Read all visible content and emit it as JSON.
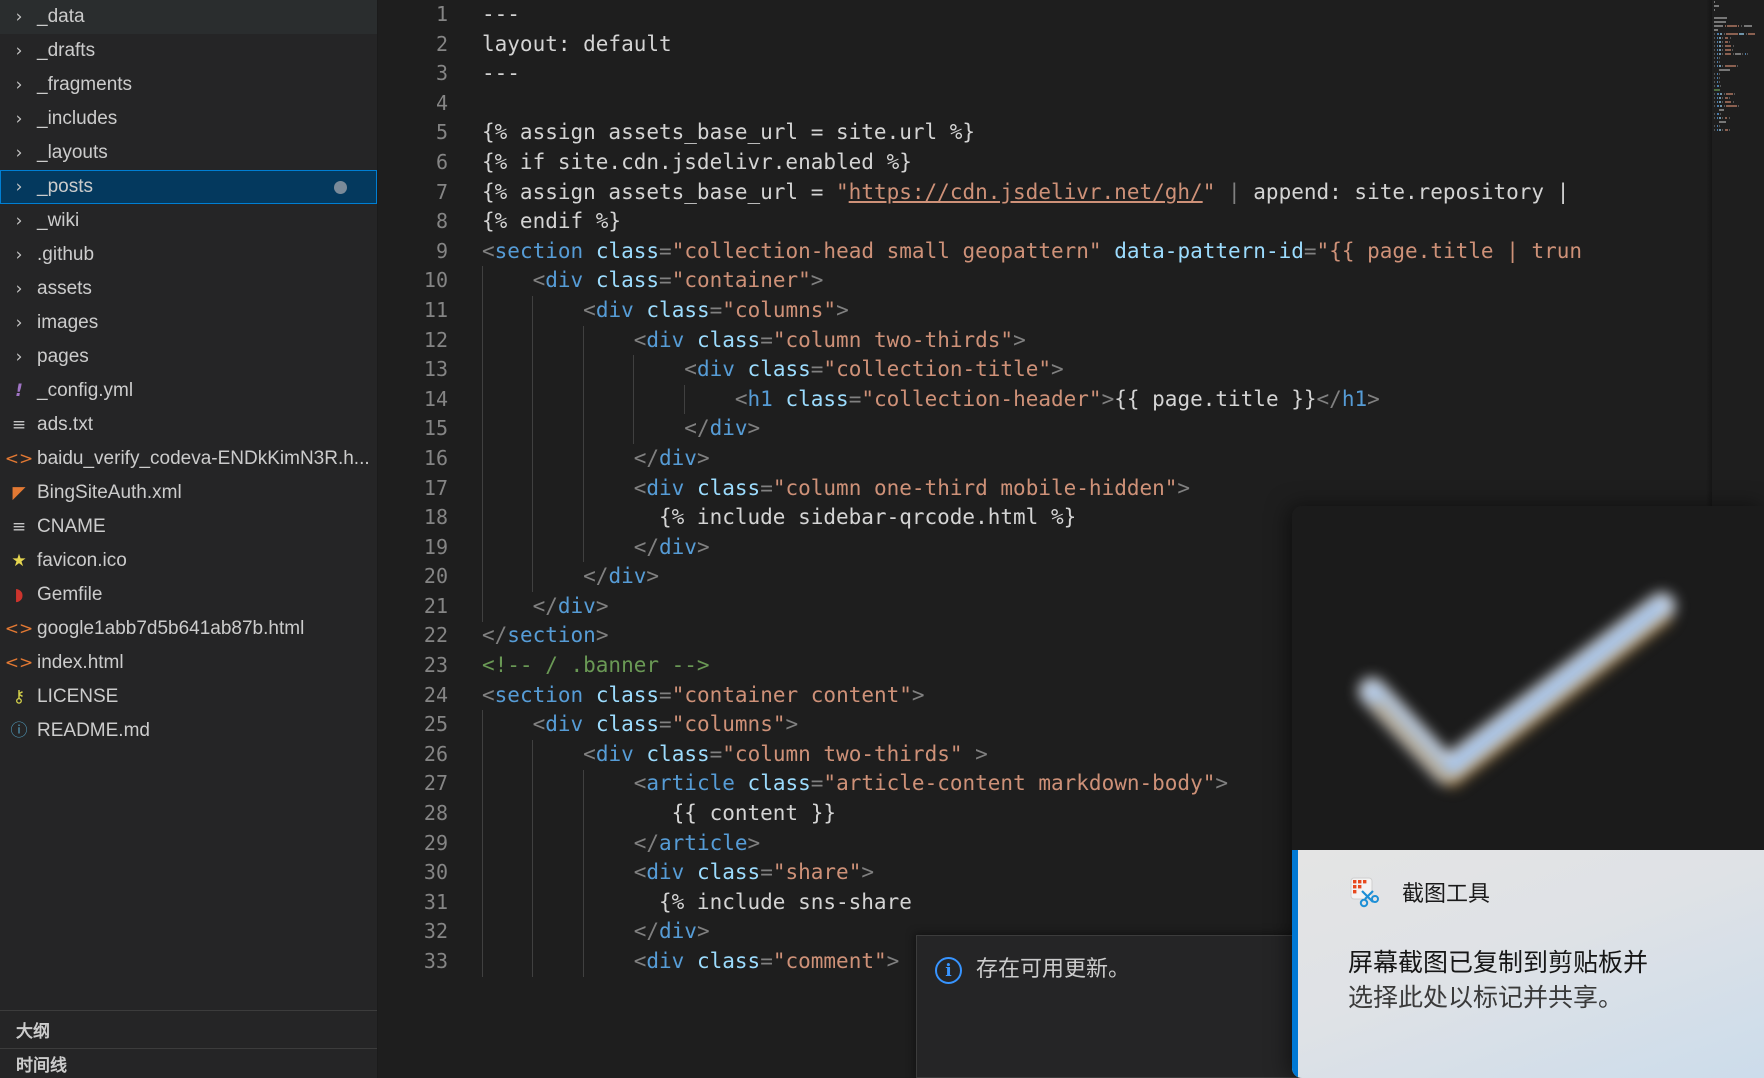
{
  "sidebar": {
    "explorer_items": [
      {
        "label": "_data",
        "kind": "folder",
        "icon": "chevron-right-icon",
        "state": "hovered"
      },
      {
        "label": "_drafts",
        "kind": "folder",
        "icon": "chevron-right-icon",
        "state": "normal"
      },
      {
        "label": "_fragments",
        "kind": "folder",
        "icon": "chevron-right-icon",
        "state": "normal"
      },
      {
        "label": "_includes",
        "kind": "folder",
        "icon": "chevron-right-icon",
        "state": "normal"
      },
      {
        "label": "_layouts",
        "kind": "folder",
        "icon": "chevron-right-icon",
        "state": "normal"
      },
      {
        "label": "_posts",
        "kind": "folder",
        "icon": "chevron-right-icon",
        "state": "selected",
        "badge": "dirty-dot"
      },
      {
        "label": "_wiki",
        "kind": "folder",
        "icon": "chevron-right-icon",
        "state": "normal"
      },
      {
        "label": ".github",
        "kind": "folder",
        "icon": "chevron-right-icon",
        "state": "normal"
      },
      {
        "label": "assets",
        "kind": "folder",
        "icon": "chevron-right-icon",
        "state": "normal"
      },
      {
        "label": "images",
        "kind": "folder",
        "icon": "chevron-right-icon",
        "state": "normal"
      },
      {
        "label": "pages",
        "kind": "folder",
        "icon": "chevron-right-icon",
        "state": "normal"
      },
      {
        "label": "_config.yml",
        "kind": "file",
        "icon": "yaml-file-icon",
        "glyph": "!",
        "color": "#a074c4"
      },
      {
        "label": "ads.txt",
        "kind": "file",
        "icon": "text-file-icon",
        "glyph": "≡",
        "color": "#c5c5c5"
      },
      {
        "label": "baidu_verify_codeva-ENDkKimN3R.h...",
        "kind": "file",
        "icon": "html-file-icon",
        "glyph": "<>",
        "color": "#e37933"
      },
      {
        "label": "BingSiteAuth.xml",
        "kind": "file",
        "icon": "xml-file-icon",
        "glyph": "◤",
        "color": "#e37933"
      },
      {
        "label": "CNAME",
        "kind": "file",
        "icon": "text-file-icon",
        "glyph": "≡",
        "color": "#c5c5c5"
      },
      {
        "label": "favicon.ico",
        "kind": "file",
        "icon": "star-file-icon",
        "glyph": "★",
        "color": "#e5d54f"
      },
      {
        "label": "Gemfile",
        "kind": "file",
        "icon": "ruby-gem-icon",
        "glyph": "◗",
        "color": "#cc342d"
      },
      {
        "label": "google1abb7d5b641ab87b.html",
        "kind": "file",
        "icon": "html-file-icon",
        "glyph": "<>",
        "color": "#e37933"
      },
      {
        "label": "index.html",
        "kind": "file",
        "icon": "html-file-icon",
        "glyph": "<>",
        "color": "#e37933"
      },
      {
        "label": "LICENSE",
        "kind": "file",
        "icon": "key-file-icon",
        "glyph": "⚷",
        "color": "#d4d14a"
      },
      {
        "label": "README.md",
        "kind": "file",
        "icon": "markdown-info-icon",
        "glyph": "ⓘ",
        "color": "#519aba"
      }
    ],
    "outline_label": "大纲",
    "timeline_label": "时间线"
  },
  "editor": {
    "first_visible_line": 1,
    "lines": [
      {
        "n": "1",
        "tokens": [
          {
            "t": "def",
            "v": "---"
          }
        ]
      },
      {
        "n": "2",
        "tokens": [
          {
            "t": "def",
            "v": "layout: default"
          }
        ]
      },
      {
        "n": "3",
        "tokens": [
          {
            "t": "def",
            "v": "---"
          }
        ]
      },
      {
        "n": "4",
        "tokens": [
          {
            "t": "def",
            "v": ""
          }
        ]
      },
      {
        "n": "5",
        "tokens": [
          {
            "t": "def",
            "v": "{% assign assets_base_url = site.url %}"
          }
        ]
      },
      {
        "n": "6",
        "tokens": [
          {
            "t": "def",
            "v": "{% if site.cdn.jsdelivr.enabled %}"
          }
        ]
      },
      {
        "n": "7",
        "tokens": [
          {
            "t": "def",
            "v": "{% assign assets_base_url = "
          },
          {
            "t": "str",
            "v": "\""
          },
          {
            "t": "link",
            "v": "https://cdn.jsdelivr.net/gh/"
          },
          {
            "t": "str",
            "v": "\""
          },
          {
            "t": "punc",
            "v": " | "
          },
          {
            "t": "def",
            "v": "append: site.repository |"
          }
        ]
      },
      {
        "n": "8",
        "tokens": [
          {
            "t": "def",
            "v": "{% endif %}"
          }
        ]
      },
      {
        "n": "9",
        "tokens": [
          {
            "t": "punc",
            "v": "<"
          },
          {
            "t": "tag",
            "v": "section"
          },
          {
            "t": "def",
            "v": " "
          },
          {
            "t": "attr",
            "v": "class"
          },
          {
            "t": "punc",
            "v": "="
          },
          {
            "t": "str",
            "v": "\"collection-head small geopattern\""
          },
          {
            "t": "def",
            "v": " "
          },
          {
            "t": "attr",
            "v": "data-pattern-id"
          },
          {
            "t": "punc",
            "v": "="
          },
          {
            "t": "str",
            "v": "\"{{ page.title | trun"
          }
        ]
      },
      {
        "n": "10",
        "tokens": [
          {
            "t": "def",
            "v": "    "
          },
          {
            "t": "punc",
            "v": "<"
          },
          {
            "t": "tag",
            "v": "div"
          },
          {
            "t": "def",
            "v": " "
          },
          {
            "t": "attr",
            "v": "class"
          },
          {
            "t": "punc",
            "v": "="
          },
          {
            "t": "str",
            "v": "\"container\""
          },
          {
            "t": "punc",
            "v": ">"
          }
        ]
      },
      {
        "n": "11",
        "tokens": [
          {
            "t": "def",
            "v": "        "
          },
          {
            "t": "punc",
            "v": "<"
          },
          {
            "t": "tag",
            "v": "div"
          },
          {
            "t": "def",
            "v": " "
          },
          {
            "t": "attr",
            "v": "class"
          },
          {
            "t": "punc",
            "v": "="
          },
          {
            "t": "str",
            "v": "\"columns\""
          },
          {
            "t": "punc",
            "v": ">"
          }
        ]
      },
      {
        "n": "12",
        "tokens": [
          {
            "t": "def",
            "v": "            "
          },
          {
            "t": "punc",
            "v": "<"
          },
          {
            "t": "tag",
            "v": "div"
          },
          {
            "t": "def",
            "v": " "
          },
          {
            "t": "attr",
            "v": "class"
          },
          {
            "t": "punc",
            "v": "="
          },
          {
            "t": "str",
            "v": "\"column two-thirds\""
          },
          {
            "t": "punc",
            "v": ">"
          }
        ]
      },
      {
        "n": "13",
        "tokens": [
          {
            "t": "def",
            "v": "                "
          },
          {
            "t": "punc",
            "v": "<"
          },
          {
            "t": "tag",
            "v": "div"
          },
          {
            "t": "def",
            "v": " "
          },
          {
            "t": "attr",
            "v": "class"
          },
          {
            "t": "punc",
            "v": "="
          },
          {
            "t": "str",
            "v": "\"collection-title\""
          },
          {
            "t": "punc",
            "v": ">"
          }
        ]
      },
      {
        "n": "14",
        "tokens": [
          {
            "t": "def",
            "v": "                    "
          },
          {
            "t": "punc",
            "v": "<"
          },
          {
            "t": "tag",
            "v": "h1"
          },
          {
            "t": "def",
            "v": " "
          },
          {
            "t": "attr",
            "v": "class"
          },
          {
            "t": "punc",
            "v": "="
          },
          {
            "t": "str",
            "v": "\"collection-header\""
          },
          {
            "t": "punc",
            "v": ">"
          },
          {
            "t": "def",
            "v": "{{ page.title }}"
          },
          {
            "t": "punc",
            "v": "</"
          },
          {
            "t": "tag",
            "v": "h1"
          },
          {
            "t": "punc",
            "v": ">"
          }
        ]
      },
      {
        "n": "15",
        "tokens": [
          {
            "t": "def",
            "v": "                "
          },
          {
            "t": "punc",
            "v": "</"
          },
          {
            "t": "tag",
            "v": "div"
          },
          {
            "t": "punc",
            "v": ">"
          }
        ]
      },
      {
        "n": "16",
        "tokens": [
          {
            "t": "def",
            "v": "            "
          },
          {
            "t": "punc",
            "v": "</"
          },
          {
            "t": "tag",
            "v": "div"
          },
          {
            "t": "punc",
            "v": ">"
          }
        ]
      },
      {
        "n": "17",
        "tokens": [
          {
            "t": "def",
            "v": "            "
          },
          {
            "t": "punc",
            "v": "<"
          },
          {
            "t": "tag",
            "v": "div"
          },
          {
            "t": "def",
            "v": " "
          },
          {
            "t": "attr",
            "v": "class"
          },
          {
            "t": "punc",
            "v": "="
          },
          {
            "t": "str",
            "v": "\"column one-third mobile-hidden\""
          },
          {
            "t": "punc",
            "v": ">"
          }
        ]
      },
      {
        "n": "18",
        "tokens": [
          {
            "t": "def",
            "v": "              {% include sidebar-qrcode.html %}"
          }
        ]
      },
      {
        "n": "19",
        "tokens": [
          {
            "t": "def",
            "v": "            "
          },
          {
            "t": "punc",
            "v": "</"
          },
          {
            "t": "tag",
            "v": "div"
          },
          {
            "t": "punc",
            "v": ">"
          }
        ]
      },
      {
        "n": "20",
        "tokens": [
          {
            "t": "def",
            "v": "        "
          },
          {
            "t": "punc",
            "v": "</"
          },
          {
            "t": "tag",
            "v": "div"
          },
          {
            "t": "punc",
            "v": ">"
          }
        ]
      },
      {
        "n": "21",
        "tokens": [
          {
            "t": "def",
            "v": "    "
          },
          {
            "t": "punc",
            "v": "</"
          },
          {
            "t": "tag",
            "v": "div"
          },
          {
            "t": "punc",
            "v": ">"
          }
        ]
      },
      {
        "n": "22",
        "tokens": [
          {
            "t": "punc",
            "v": "</"
          },
          {
            "t": "tag",
            "v": "section"
          },
          {
            "t": "punc",
            "v": ">"
          }
        ]
      },
      {
        "n": "23",
        "tokens": [
          {
            "t": "com",
            "v": "<!-- / .banner -->"
          }
        ]
      },
      {
        "n": "24",
        "tokens": [
          {
            "t": "punc",
            "v": "<"
          },
          {
            "t": "tag",
            "v": "section"
          },
          {
            "t": "def",
            "v": " "
          },
          {
            "t": "attr",
            "v": "class"
          },
          {
            "t": "punc",
            "v": "="
          },
          {
            "t": "str",
            "v": "\"container content\""
          },
          {
            "t": "punc",
            "v": ">"
          }
        ]
      },
      {
        "n": "25",
        "tokens": [
          {
            "t": "def",
            "v": "    "
          },
          {
            "t": "punc",
            "v": "<"
          },
          {
            "t": "tag",
            "v": "div"
          },
          {
            "t": "def",
            "v": " "
          },
          {
            "t": "attr",
            "v": "class"
          },
          {
            "t": "punc",
            "v": "="
          },
          {
            "t": "str",
            "v": "\"columns\""
          },
          {
            "t": "punc",
            "v": ">"
          }
        ]
      },
      {
        "n": "26",
        "tokens": [
          {
            "t": "def",
            "v": "        "
          },
          {
            "t": "punc",
            "v": "<"
          },
          {
            "t": "tag",
            "v": "div"
          },
          {
            "t": "def",
            "v": " "
          },
          {
            "t": "attr",
            "v": "class"
          },
          {
            "t": "punc",
            "v": "="
          },
          {
            "t": "str",
            "v": "\"column two-thirds\""
          },
          {
            "t": "def",
            "v": " "
          },
          {
            "t": "punc",
            "v": ">"
          }
        ]
      },
      {
        "n": "27",
        "tokens": [
          {
            "t": "def",
            "v": "            "
          },
          {
            "t": "punc",
            "v": "<"
          },
          {
            "t": "tag",
            "v": "article"
          },
          {
            "t": "def",
            "v": " "
          },
          {
            "t": "attr",
            "v": "class"
          },
          {
            "t": "punc",
            "v": "="
          },
          {
            "t": "str",
            "v": "\"article-content markdown-body\""
          },
          {
            "t": "punc",
            "v": ">"
          }
        ]
      },
      {
        "n": "28",
        "tokens": [
          {
            "t": "def",
            "v": "               {{ content }}"
          }
        ]
      },
      {
        "n": "29",
        "tokens": [
          {
            "t": "def",
            "v": "            "
          },
          {
            "t": "punc",
            "v": "</"
          },
          {
            "t": "tag",
            "v": "article"
          },
          {
            "t": "punc",
            "v": ">"
          }
        ]
      },
      {
        "n": "30",
        "tokens": [
          {
            "t": "def",
            "v": "            "
          },
          {
            "t": "punc",
            "v": "<"
          },
          {
            "t": "tag",
            "v": "div"
          },
          {
            "t": "def",
            "v": " "
          },
          {
            "t": "attr",
            "v": "class"
          },
          {
            "t": "punc",
            "v": "="
          },
          {
            "t": "str",
            "v": "\"share\""
          },
          {
            "t": "punc",
            "v": ">"
          }
        ]
      },
      {
        "n": "31",
        "tokens": [
          {
            "t": "def",
            "v": "              {% include sns-share"
          }
        ]
      },
      {
        "n": "32",
        "tokens": [
          {
            "t": "def",
            "v": "            "
          },
          {
            "t": "punc",
            "v": "</"
          },
          {
            "t": "tag",
            "v": "div"
          },
          {
            "t": "punc",
            "v": ">"
          }
        ]
      },
      {
        "n": "33",
        "tokens": [
          {
            "t": "def",
            "v": "            "
          },
          {
            "t": "punc",
            "v": "<"
          },
          {
            "t": "tag",
            "v": "div"
          },
          {
            "t": "def",
            "v": " "
          },
          {
            "t": "attr",
            "v": "class"
          },
          {
            "t": "punc",
            "v": "="
          },
          {
            "t": "str",
            "v": "\"comment\""
          },
          {
            "t": "punc",
            "v": ">"
          }
        ]
      }
    ]
  },
  "vscode_notification": {
    "icon": "info-icon",
    "message": "存在可用更新。"
  },
  "windows_toast": {
    "app_icon": "snipping-tool-icon",
    "app_name": "截图工具",
    "message_line1": "屏幕截图已复制到剪贴板并",
    "message_line2": "选择此处以标记并共享。"
  },
  "colors": {
    "sidebar_bg": "#252526",
    "editor_bg": "#1e1e1e",
    "selected_row_bg": "#04395e",
    "selected_row_border": "#007fd4",
    "tag": "#569cd6",
    "attr": "#9cdcfe",
    "string": "#ce9178",
    "comment": "#6a9955",
    "default_text": "#d4d4d4",
    "line_number": "#858585",
    "info_blue": "#3794ff",
    "toast_accent": "#0078d4"
  }
}
